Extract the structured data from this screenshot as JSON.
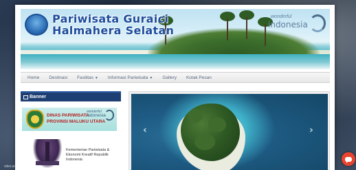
{
  "header": {
    "title_line1": "Pariwisata Guraici",
    "title_line2": "Halmahera Selatan",
    "wonderful_indonesia": {
      "small": "wonderful",
      "main": "indonesia"
    }
  },
  "nav": {
    "items": [
      {
        "label": "Home"
      },
      {
        "label": "Destinasi"
      },
      {
        "label": "Fasilitas",
        "dropdown": true
      },
      {
        "label": "Informasi Pariwisata",
        "dropdown": true
      },
      {
        "label": "Gallery"
      },
      {
        "label": "Kotak Pesan"
      }
    ]
  },
  "sidebar": {
    "title": "Banner",
    "banner1": {
      "line1": "DINAS PARIWISATA",
      "line2": "PROVINSI MALUKU UTARA",
      "wi_small": "wonderful",
      "wi_main": "indonesia"
    },
    "banner2": {
      "text": "Kementerian Pariwisata & Ekonomi Kreatif Republik Indonesia"
    }
  },
  "slider": {
    "prev_icon": "‹",
    "next_icon": "›"
  },
  "status_bar": {
    "text": "sites.ai"
  },
  "colors": {
    "nav_text": "#5a6a7d",
    "sidebar_header_bg": "#1e3f73",
    "title_blue": "#1d4d9c",
    "chat_button": "#e8452f"
  },
  "icons": {
    "chat": "chat-icon",
    "banner_header": "image-icon"
  }
}
